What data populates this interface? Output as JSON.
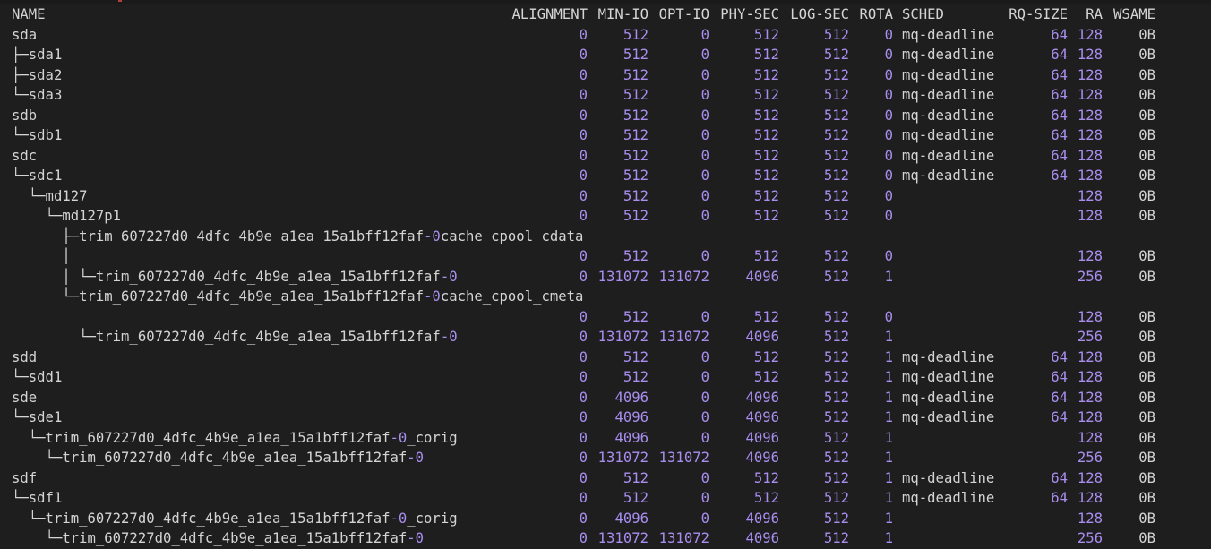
{
  "terminal": {
    "headers": {
      "name": "NAME",
      "alignment": "ALIGNMENT",
      "min_io": "MIN-IO",
      "opt_io": "OPT-IO",
      "phy_sec": "PHY-SEC",
      "log_sec": "LOG-SEC",
      "rota": "ROTA",
      "sched": "SCHED",
      "rq_size": "RQ-SIZE",
      "ra": "RA",
      "wsame": "WSAME"
    },
    "rows": [
      {
        "name": "sda",
        "alignment": "0",
        "min_io": "512",
        "opt_io": "0",
        "phy_sec": "512",
        "log_sec": "512",
        "rota": "0",
        "sched": "mq-deadline",
        "rq_size": "64",
        "ra": "128",
        "wsame": "0B"
      },
      {
        "name": "├─sda1",
        "alignment": "0",
        "min_io": "512",
        "opt_io": "0",
        "phy_sec": "512",
        "log_sec": "512",
        "rota": "0",
        "sched": "mq-deadline",
        "rq_size": "64",
        "ra": "128",
        "wsame": "0B"
      },
      {
        "name": "├─sda2",
        "alignment": "0",
        "min_io": "512",
        "opt_io": "0",
        "phy_sec": "512",
        "log_sec": "512",
        "rota": "0",
        "sched": "mq-deadline",
        "rq_size": "64",
        "ra": "128",
        "wsame": "0B"
      },
      {
        "name": "└─sda3",
        "alignment": "0",
        "min_io": "512",
        "opt_io": "0",
        "phy_sec": "512",
        "log_sec": "512",
        "rota": "0",
        "sched": "mq-deadline",
        "rq_size": "64",
        "ra": "128",
        "wsame": "0B"
      },
      {
        "name": "sdb",
        "alignment": "0",
        "min_io": "512",
        "opt_io": "0",
        "phy_sec": "512",
        "log_sec": "512",
        "rota": "0",
        "sched": "mq-deadline",
        "rq_size": "64",
        "ra": "128",
        "wsame": "0B"
      },
      {
        "name": "└─sdb1",
        "alignment": "0",
        "min_io": "512",
        "opt_io": "0",
        "phy_sec": "512",
        "log_sec": "512",
        "rota": "0",
        "sched": "mq-deadline",
        "rq_size": "64",
        "ra": "128",
        "wsame": "0B"
      },
      {
        "name": "sdc",
        "alignment": "0",
        "min_io": "512",
        "opt_io": "0",
        "phy_sec": "512",
        "log_sec": "512",
        "rota": "0",
        "sched": "mq-deadline",
        "rq_size": "64",
        "ra": "128",
        "wsame": "0B"
      },
      {
        "name": "└─sdc1",
        "alignment": "0",
        "min_io": "512",
        "opt_io": "0",
        "phy_sec": "512",
        "log_sec": "512",
        "rota": "0",
        "sched": "mq-deadline",
        "rq_size": "64",
        "ra": "128",
        "wsame": "0B"
      },
      {
        "name": "  └─md127",
        "alignment": "0",
        "min_io": "512",
        "opt_io": "0",
        "phy_sec": "512",
        "log_sec": "512",
        "rota": "0",
        "sched": "",
        "rq_size": "",
        "ra": "128",
        "wsame": "0B"
      },
      {
        "name": "    └─md127p1",
        "alignment": "0",
        "min_io": "512",
        "opt_io": "0",
        "phy_sec": "512",
        "log_sec": "512",
        "rota": "0",
        "sched": "",
        "rq_size": "",
        "ra": "128",
        "wsame": "0B"
      },
      {
        "name": "      ├─trim_607227d0_4dfc_4b9e_a1ea_15a1bff12faf-0cache_cpool_cdata",
        "alignment": "",
        "min_io": "",
        "opt_io": "",
        "phy_sec": "",
        "log_sec": "",
        "rota": "",
        "sched": "",
        "rq_size": "",
        "ra": "",
        "wsame": ""
      },
      {
        "name": "      │",
        "alignment": "0",
        "min_io": "512",
        "opt_io": "0",
        "phy_sec": "512",
        "log_sec": "512",
        "rota": "0",
        "sched": "",
        "rq_size": "",
        "ra": "128",
        "wsame": "0B"
      },
      {
        "name": "      │ └─trim_607227d0_4dfc_4b9e_a1ea_15a1bff12faf-0",
        "alignment": "0",
        "min_io": "131072",
        "opt_io": "131072",
        "phy_sec": "4096",
        "log_sec": "512",
        "rota": "1",
        "sched": "",
        "rq_size": "",
        "ra": "256",
        "wsame": "0B"
      },
      {
        "name": "      └─trim_607227d0_4dfc_4b9e_a1ea_15a1bff12faf-0cache_cpool_cmeta",
        "alignment": "",
        "min_io": "",
        "opt_io": "",
        "phy_sec": "",
        "log_sec": "",
        "rota": "",
        "sched": "",
        "rq_size": "",
        "ra": "",
        "wsame": ""
      },
      {
        "name": "",
        "alignment": "0",
        "min_io": "512",
        "opt_io": "0",
        "phy_sec": "512",
        "log_sec": "512",
        "rota": "0",
        "sched": "",
        "rq_size": "",
        "ra": "128",
        "wsame": "0B"
      },
      {
        "name": "        └─trim_607227d0_4dfc_4b9e_a1ea_15a1bff12faf-0",
        "alignment": "0",
        "min_io": "131072",
        "opt_io": "131072",
        "phy_sec": "4096",
        "log_sec": "512",
        "rota": "1",
        "sched": "",
        "rq_size": "",
        "ra": "256",
        "wsame": "0B"
      },
      {
        "name": "sdd",
        "alignment": "0",
        "min_io": "512",
        "opt_io": "0",
        "phy_sec": "512",
        "log_sec": "512",
        "rota": "1",
        "sched": "mq-deadline",
        "rq_size": "64",
        "ra": "128",
        "wsame": "0B"
      },
      {
        "name": "└─sdd1",
        "alignment": "0",
        "min_io": "512",
        "opt_io": "0",
        "phy_sec": "512",
        "log_sec": "512",
        "rota": "1",
        "sched": "mq-deadline",
        "rq_size": "64",
        "ra": "128",
        "wsame": "0B"
      },
      {
        "name": "sde",
        "alignment": "0",
        "min_io": "4096",
        "opt_io": "0",
        "phy_sec": "4096",
        "log_sec": "512",
        "rota": "1",
        "sched": "mq-deadline",
        "rq_size": "64",
        "ra": "128",
        "wsame": "0B"
      },
      {
        "name": "└─sde1",
        "alignment": "0",
        "min_io": "4096",
        "opt_io": "0",
        "phy_sec": "4096",
        "log_sec": "512",
        "rota": "1",
        "sched": "mq-deadline",
        "rq_size": "64",
        "ra": "128",
        "wsame": "0B"
      },
      {
        "name": "  └─trim_607227d0_4dfc_4b9e_a1ea_15a1bff12faf-0_corig",
        "alignment": "0",
        "min_io": "4096",
        "opt_io": "0",
        "phy_sec": "4096",
        "log_sec": "512",
        "rota": "1",
        "sched": "",
        "rq_size": "",
        "ra": "128",
        "wsame": "0B"
      },
      {
        "name": "    └─trim_607227d0_4dfc_4b9e_a1ea_15a1bff12faf-0",
        "alignment": "0",
        "min_io": "131072",
        "opt_io": "131072",
        "phy_sec": "4096",
        "log_sec": "512",
        "rota": "1",
        "sched": "",
        "rq_size": "",
        "ra": "256",
        "wsame": "0B"
      },
      {
        "name": "sdf",
        "alignment": "0",
        "min_io": "512",
        "opt_io": "0",
        "phy_sec": "512",
        "log_sec": "512",
        "rota": "1",
        "sched": "mq-deadline",
        "rq_size": "64",
        "ra": "128",
        "wsame": "0B"
      },
      {
        "name": "└─sdf1",
        "alignment": "0",
        "min_io": "512",
        "opt_io": "0",
        "phy_sec": "512",
        "log_sec": "512",
        "rota": "1",
        "sched": "mq-deadline",
        "rq_size": "64",
        "ra": "128",
        "wsame": "0B"
      },
      {
        "name": "  └─trim_607227d0_4dfc_4b9e_a1ea_15a1bff12faf-0_corig",
        "alignment": "0",
        "min_io": "4096",
        "opt_io": "0",
        "phy_sec": "4096",
        "log_sec": "512",
        "rota": "1",
        "sched": "",
        "rq_size": "",
        "ra": "128",
        "wsame": "0B"
      },
      {
        "name": "    └─trim_607227d0_4dfc_4b9e_a1ea_15a1bff12faf-0",
        "alignment": "0",
        "min_io": "131072",
        "opt_io": "131072",
        "phy_sec": "4096",
        "log_sec": "512",
        "rota": "1",
        "sched": "",
        "rq_size": "",
        "ra": "256",
        "wsame": "0B"
      }
    ]
  },
  "colors": {
    "background": "#1e1e1e",
    "text": "#d4d4d4",
    "number": "#a98ef0"
  }
}
